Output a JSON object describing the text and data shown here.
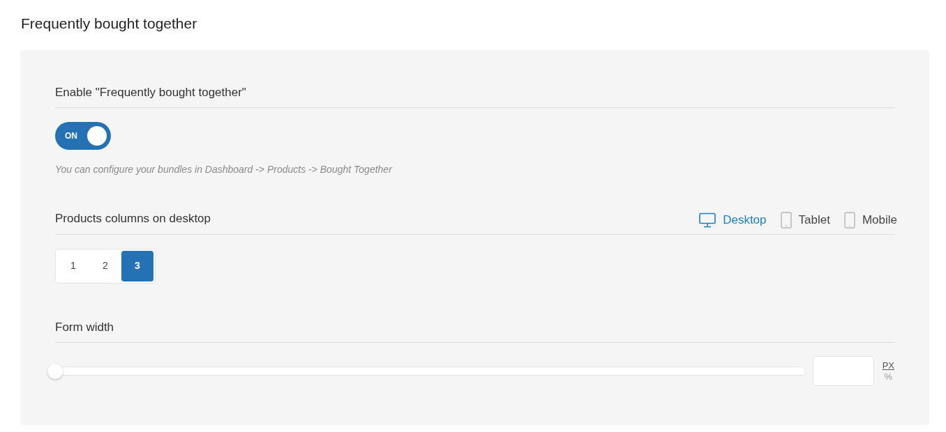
{
  "page_title": "Frequently bought together",
  "enable": {
    "label": "Enable \"Frequently bought together\"",
    "toggle": {
      "label": "ON",
      "on": true
    },
    "hint": "You can configure your bundles in Dashboard -> Products -> Bought Together"
  },
  "columns": {
    "label": "Products columns on desktop",
    "devices": [
      {
        "label": "Desktop",
        "kind": "monitor",
        "selected": true
      },
      {
        "label": "Tablet",
        "kind": "tablet",
        "selected": false
      },
      {
        "label": "Mobile",
        "kind": "phone",
        "selected": false
      }
    ],
    "options": [
      {
        "label": "1",
        "selected": false
      },
      {
        "label": "2",
        "selected": false
      },
      {
        "label": "3",
        "selected": true
      }
    ]
  },
  "form_width": {
    "label": "Form width",
    "slider": {
      "level": 0
    },
    "units": [
      {
        "label": "PX",
        "selected": true
      },
      {
        "label": "%",
        "selected": false
      }
    ]
  }
}
